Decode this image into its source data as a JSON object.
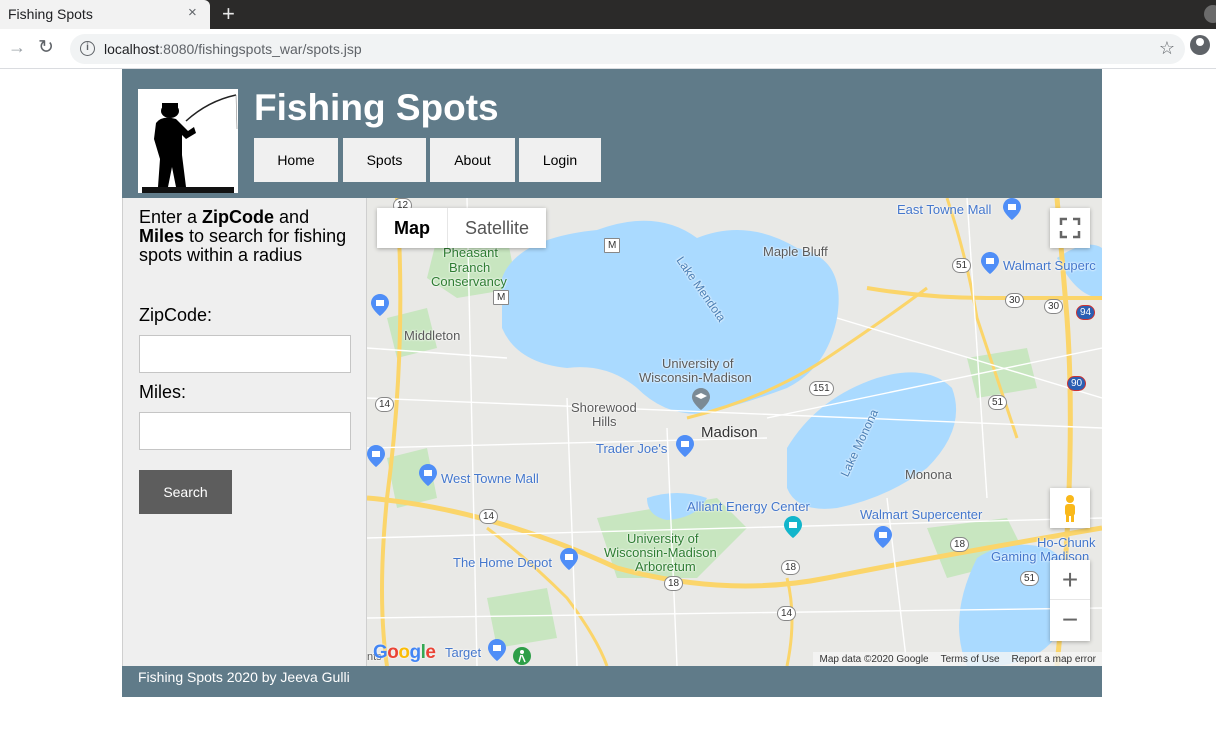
{
  "browser": {
    "tab_title": "Fishing Spots",
    "tab_close": "×",
    "new_tab": "+",
    "url_host": "localhost",
    "url_path": ":8080/fishingspots_war/spots.jsp"
  },
  "header": {
    "title": "Fishing Spots",
    "nav": [
      "Home",
      "Spots",
      "About",
      "Login"
    ]
  },
  "search_form": {
    "instruction_prefix": "Enter a ",
    "instruction_zip": "ZipCode",
    "instruction_and": " and ",
    "instruction_miles": "Miles",
    "instruction_suffix": " to search for fishing spots within a radius",
    "zip_label": "ZipCode:",
    "zip_value": "",
    "miles_label": "Miles:",
    "miles_value": "",
    "search_label": "Search"
  },
  "map": {
    "type_map": "Map",
    "type_satellite": "Satellite",
    "zoom_in": "+",
    "zoom_out": "−",
    "labels": {
      "east_towne_mall": "East Towne Mall",
      "walmart_superc": "Walmart Superc",
      "maple_bluff": "Maple Bluff",
      "pheasant": "Pheasant",
      "branch": "Branch",
      "conservancy": "Conservancy",
      "middleton": "Middleton",
      "lake_mendota": "Lake Mendota",
      "university_of": "University of",
      "wisconsin_madison": "Wisconsin-Madison",
      "shorewood": "Shorewood",
      "hills": "Hills",
      "madison": "Madison",
      "trader_joes": "Trader Joe's",
      "lake_monona": "Lake Monona",
      "monona": "Monona",
      "west_towne_mall": "West Towne Mall",
      "alliant": "Alliant Energy Center",
      "walmart_supercenter": "Walmart Supercenter",
      "ho_chunk": "Ho-Chunk",
      "gaming_madison": "Gaming Madison",
      "arboretum_1": "University of",
      "arboretum_2": "Wisconsin-Madison",
      "arboretum_3": "Arboretum",
      "home_depot": "The Home Depot",
      "target": "Target",
      "nts": "nts"
    },
    "shields": {
      "r12": "12",
      "m1": "M",
      "m2": "M",
      "r51a": "51",
      "r30a": "30",
      "r30b": "30",
      "i94": "94",
      "r14a": "14",
      "r151": "151",
      "r51b": "51",
      "i90": "90",
      "r14b": "14",
      "r18a": "18",
      "r18b": "18",
      "r18c": "18",
      "r51c": "51",
      "r14c": "14"
    },
    "google": "Google",
    "attribution": [
      "Map data ©2020 Google",
      "Terms of Use",
      "Report a map error"
    ],
    "colors": {
      "water": "#aadaff",
      "park": "#c8e6c0",
      "highway": "#fbd56a",
      "land": "#e9e9e6"
    }
  },
  "footer": {
    "text": "Fishing Spots 2020 by Jeeva Gulli"
  }
}
